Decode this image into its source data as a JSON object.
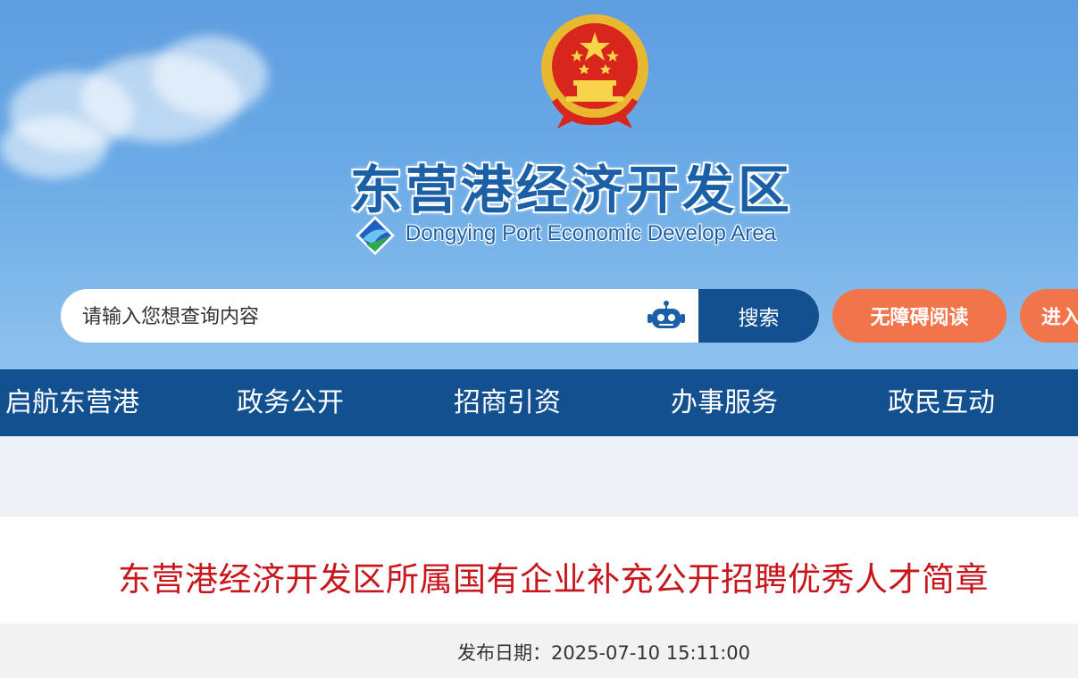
{
  "header": {
    "title": "东营港经济开发区",
    "subtitle": "Dongying Port Economic Develop Area"
  },
  "search": {
    "placeholder": "请输入您想查询内容",
    "button_label": "搜索"
  },
  "actions": {
    "accessibility_label": "无障碍阅读",
    "enter_label": "进入"
  },
  "nav": {
    "items": [
      {
        "label": "启航东营港"
      },
      {
        "label": "政务公开"
      },
      {
        "label": "招商引资"
      },
      {
        "label": "办事服务"
      },
      {
        "label": "政民互动"
      }
    ]
  },
  "article": {
    "title": "东营港经济开发区所属国有企业补充公开招聘优秀人才简章",
    "publish_label": "发布日期：",
    "publish_date": "2025-07-10 15:11:00"
  },
  "colors": {
    "nav_blue": "#12508f",
    "accent_orange": "#f2744a",
    "title_red": "#c7161c"
  },
  "icons": [
    "national-emblem-icon",
    "port-logo-icon",
    "robot-icon"
  ]
}
